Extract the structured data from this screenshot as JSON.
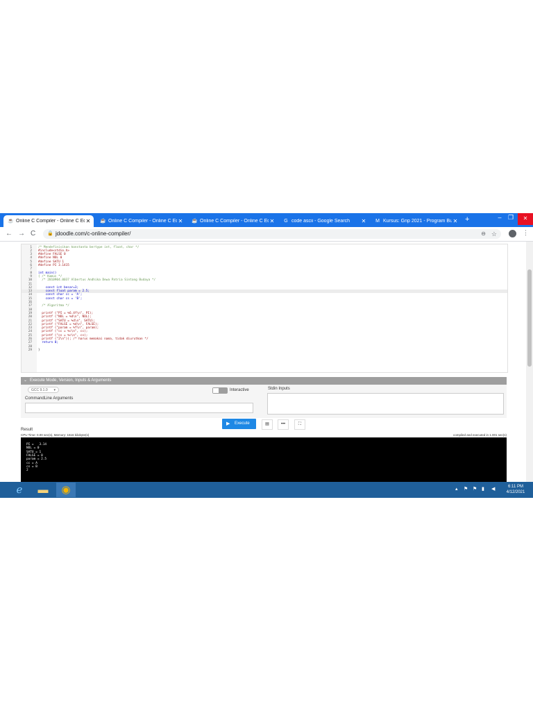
{
  "browser": {
    "tabs": [
      {
        "title": "Online C Compiler - Online C Ed",
        "icon": "jdoodle-icon",
        "active": true
      },
      {
        "title": "Online C Compiler - Online C Ed",
        "icon": "jdoodle-icon",
        "active": false
      },
      {
        "title": "Online C Compiler - Online C Ed",
        "icon": "jdoodle-icon",
        "active": false
      },
      {
        "title": "code ascii - Google Search",
        "icon": "google-icon",
        "active": false
      },
      {
        "title": "Kursus: Gnp 2021 - Program Bu",
        "icon": "moodle-icon",
        "active": false
      }
    ],
    "tab_close_glyph": "✕",
    "new_tab_glyph": "+",
    "url": "jdoodle.com/c-online-compiler/",
    "nav": {
      "back": "←",
      "forward": "→",
      "reload": "C"
    },
    "window_controls": {
      "minimize": "–",
      "maximize": "❐",
      "close": "✕"
    }
  },
  "editor": {
    "lines": [
      {
        "n": "1",
        "text": "/* Mendefinisikan konstanta bertype int, float, char */",
        "cls": "c-comment"
      },
      {
        "n": "2",
        "text": "#include<stdio.h>",
        "cls": "c-pre"
      },
      {
        "n": "3",
        "text": "#define FALSE 0",
        "cls": "c-pre"
      },
      {
        "n": "4",
        "text": "#define NOL 0",
        "cls": "c-pre"
      },
      {
        "n": "5",
        "text": "#define SATU 1",
        "cls": "c-pre"
      },
      {
        "n": "6",
        "text": "#define PI 3.1415",
        "cls": "c-pre"
      },
      {
        "n": "7",
        "text": "",
        "cls": "c-plain"
      },
      {
        "n": "8",
        "text": "int main()",
        "cls": "c-kw"
      },
      {
        "n": "9",
        "text": "{ /* Kamus */",
        "cls": "c-comment"
      },
      {
        "n": "10",
        "text": "  /* 2010904.0037 Albertus Andhika Dewa Patria Sintang Budaya */",
        "cls": "c-comment"
      },
      {
        "n": "11",
        "text": "",
        "cls": "c-plain"
      },
      {
        "n": "12",
        "text": "    const int besar=3;",
        "cls": "c-kw"
      },
      {
        "n": "13",
        "text": "    const float param = 2.5;",
        "cls": "c-kw"
      },
      {
        "n": "14",
        "text": "    const char cc = 'A';",
        "cls": "c-kw"
      },
      {
        "n": "15",
        "text": "    const char cs = 'B';",
        "cls": "c-kw"
      },
      {
        "n": "16",
        "text": "",
        "cls": "c-plain"
      },
      {
        "n": "17",
        "text": "  /* Algoritma */",
        "cls": "c-comment"
      },
      {
        "n": "18",
        "text": "",
        "cls": "c-plain"
      },
      {
        "n": "19",
        "text": "  printf (\"PI = %6.4f\\n\", PI);",
        "cls": "c-str"
      },
      {
        "n": "20",
        "text": "  printf (\"NOL = %d\\n\", NOL);",
        "cls": "c-str"
      },
      {
        "n": "21",
        "text": "  printf (\"SATU = %d\\n\", SATU);",
        "cls": "c-str"
      },
      {
        "n": "22",
        "text": "  printf (\"FALSE = %d\\n\", FALSE);",
        "cls": "c-str"
      },
      {
        "n": "23",
        "text": "  printf (\"param = %f\\n\", param);",
        "cls": "c-str"
      },
      {
        "n": "24",
        "text": "  printf (\"cc = %c\\n\", cc);",
        "cls": "c-str"
      },
      {
        "n": "25",
        "text": "  printf (\"cs = %c\\n\", cs);",
        "cls": "c-str"
      },
      {
        "n": "26",
        "text": "  printf (\"2\\n\")); /* harus memakai nama, tidak diurutkan */",
        "cls": "c-str"
      },
      {
        "n": "27",
        "text": "  return 0;",
        "cls": "c-kw"
      },
      {
        "n": "28",
        "text": "",
        "cls": "c-plain"
      },
      {
        "n": "29",
        "text": "}",
        "cls": "c-plain"
      }
    ],
    "highlight_line": 13
  },
  "options": {
    "header": "Execute Mode, Version, Inputs & Arguments",
    "compiler_version": "GCC 9.1.0",
    "interactive_label": "Interactive",
    "interactive_on": false,
    "cmd_args_label": "CommandLine Arguments",
    "stdin_label": "Stdin Inputs"
  },
  "actions": {
    "execute_label": "Execute",
    "save_glyph": "▤",
    "more_glyph": "•••",
    "fullscreen_glyph": "⛶"
  },
  "result": {
    "label": "Result",
    "cpu_info": "CPU Time: 0.00 sec(s), Memory: 1516 kilobyte(s)",
    "compiled_info": "compiled and executed in 1.001 sec(s)",
    "output_lines": [
      "PI =   3.14",
      "NOL = 0",
      "SATU = 1",
      "FALSE = 0",
      "param = 2.5",
      "cc = A",
      "cs = B",
      "2"
    ]
  },
  "taskbar": {
    "time": "6:11 PM",
    "date": "4/12/2021",
    "color": "#1f5f9a"
  },
  "colors": {
    "chrome_tabbar": "#1a73e8",
    "execute_button": "#1e88e5",
    "console_bg": "#000000"
  }
}
